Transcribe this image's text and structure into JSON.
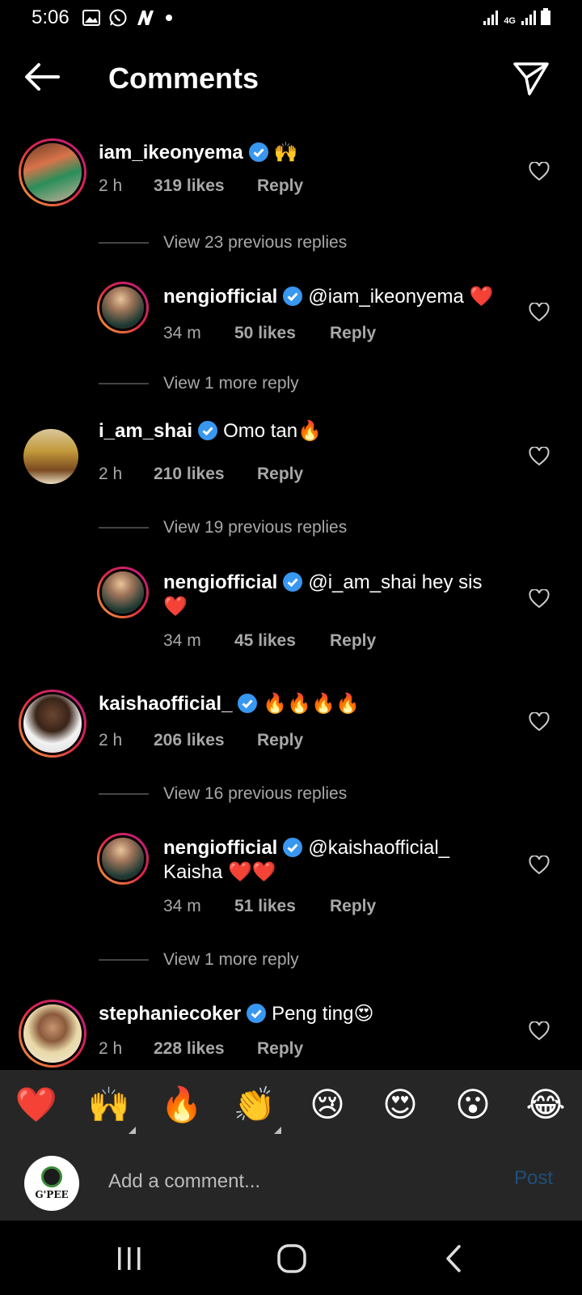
{
  "status_bar": {
    "time": "5:06",
    "left_icons": [
      "gallery-icon",
      "whatsapp-icon",
      "n-app-icon",
      "dot-icon"
    ],
    "right_icons": [
      "signal-icon",
      "4g-icon",
      "signal-icon",
      "battery-icon"
    ],
    "network_label": "4G"
  },
  "header": {
    "title": "Comments",
    "back_icon": "arrow-left-icon",
    "share_icon": "paper-plane-icon"
  },
  "comments": [
    {
      "user": "iam_ikeonyema",
      "verified": true,
      "text": "🙌",
      "time": "2 h",
      "likes": "319 likes",
      "reply": "Reply",
      "is_reply": false
    },
    {
      "view_more": "View 23 previous replies"
    },
    {
      "user": "nengiofficial",
      "verified": true,
      "text": "@iam_ikeonyema ❤️",
      "time": "34 m",
      "likes": "50 likes",
      "reply": "Reply",
      "is_reply": true
    },
    {
      "view_more": "View 1 more reply"
    },
    {
      "user": "i_am_shai",
      "verified": true,
      "text": "Omo tan🔥",
      "time": "2 h",
      "likes": "210 likes",
      "reply": "Reply",
      "is_reply": false
    },
    {
      "view_more": "View 19 previous replies"
    },
    {
      "user": "nengiofficial",
      "verified": true,
      "text": "@i_am_shai hey sis",
      "text2": "❤️",
      "time": "34 m",
      "likes": "45 likes",
      "reply": "Reply",
      "is_reply": true
    },
    {
      "user": "kaishaofficial_",
      "verified": true,
      "text": "🔥🔥🔥🔥",
      "time": "2 h",
      "likes": "206 likes",
      "reply": "Reply",
      "is_reply": false
    },
    {
      "view_more": "View 16 previous replies"
    },
    {
      "user": "nengiofficial",
      "verified": true,
      "text": "@kaishaofficial_",
      "text2": "Kaisha ❤️❤️",
      "time": "34 m",
      "likes": "51 likes",
      "reply": "Reply",
      "is_reply": true
    },
    {
      "view_more": "View 1 more reply"
    },
    {
      "user": "stephaniecoker",
      "verified": true,
      "text": "Peng ting😍",
      "time": "2 h",
      "likes": "228 likes",
      "reply": "Reply",
      "is_reply": false
    }
  ],
  "emoji_bar": [
    "❤️",
    "🙌",
    "🔥",
    "👏",
    "😢",
    "😍",
    "😮",
    "😂"
  ],
  "compose": {
    "avatar_text": "G'PEE",
    "placeholder": "Add a comment...",
    "post_label": "Post"
  },
  "navbar": {
    "recents_icon": "recents-icon",
    "home_icon": "home-icon",
    "back_icon": "back-chevron-icon"
  },
  "colors": {
    "background": "#000000",
    "bar": "#262626",
    "muted_text": "#a8a8a8",
    "verified": "#3897f0",
    "post_disabled": "#1f4f7a"
  }
}
